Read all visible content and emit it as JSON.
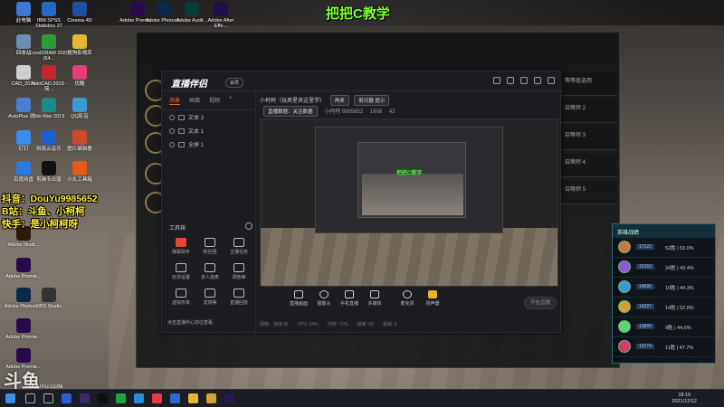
{
  "overlay_title": "把把C教学",
  "overlay_lines": [
    "抖音：DouYu9985652",
    "B站：斗鱼、小柯柯",
    "快手：是小柯柯呀"
  ],
  "desktop_icons": [
    {
      "label": "此电脑",
      "color": "#3a7bd5"
    },
    {
      "label": "IBM SPSS Statistics 27",
      "color": "#2468c9"
    },
    {
      "label": "Cinema 4D",
      "color": "#1e4fa3"
    },
    {
      "label": "Adobe Premie...",
      "color": "#2a0a4a"
    },
    {
      "label": "Adobe Photosh...",
      "color": "#0a2a4a"
    },
    {
      "label": "Adobe Audit...",
      "color": "#0a3a3a"
    },
    {
      "label": "Adobe After Effe...",
      "color": "#22104a"
    },
    {
      "label": "回收站",
      "color": "#6b8fb5"
    },
    {
      "label": "CorelDRAW 2020 (64...",
      "color": "#2d9b3a"
    },
    {
      "label": "搜狗影视库",
      "color": "#e6b733"
    },
    {
      "label": "CAD_2019",
      "color": "#cfcfcf"
    },
    {
      "label": "AutoCAD 2019 - 简...",
      "color": "#c4262e"
    },
    {
      "label": "优酷",
      "color": "#e6407a"
    },
    {
      "label": "AutoPlus 测...",
      "color": "#4a7fd5"
    },
    {
      "label": "3ds Max 2019",
      "color": "#1a8a8a"
    },
    {
      "label": "QQ影音",
      "color": "#3a9ad5"
    },
    {
      "label": "钉钉",
      "color": "#3a8ef0"
    },
    {
      "label": "网易云音乐",
      "color": "#1e5fcf"
    },
    {
      "label": "图片编辑器",
      "color": "#c94a2a"
    },
    {
      "label": "百度网盘",
      "color": "#2a7ae0"
    },
    {
      "label": "剪映专业版",
      "color": "#111111"
    },
    {
      "label": "小丸工具箱",
      "color": "#e35a1a"
    },
    {
      "label": "OBS Studio",
      "color": "#333333"
    },
    {
      "label": "Adobe Illustr...",
      "color": "#2b1a0a"
    },
    {
      "label": "Adobe Premie...",
      "color": "#2a0a4a"
    },
    {
      "label": "Adobe Photosh...",
      "color": "#0a2a4a"
    },
    {
      "label": "Adobe Premie...",
      "color": "#2a0a4a"
    },
    {
      "label": "Adobe Premie...",
      "color": "#2a0a4a"
    }
  ],
  "app": {
    "logo": "直播伴侣",
    "badge": "会员",
    "tabs": [
      "场景",
      "画面",
      "视频"
    ],
    "layers": [
      "文本 3",
      "文本 1",
      "全屏 1"
    ],
    "tools_header": "工具箱",
    "tools": [
      "弹幕助手",
      "粉丝团",
      "主播任务",
      "玩法设置",
      "多人连麦",
      "调色等",
      "虚拟形象",
      "滤镜等",
      "直播回放"
    ],
    "notice": "点击直播中心前往查看",
    "header_title": "小柯柯（玩男星来这里学）",
    "header_btn": "再来",
    "header_btn2": "剪切器 提示",
    "row2": [
      "直播数据：关注数据",
      "小柯柯 9985652",
      "1608",
      "42"
    ],
    "bottom_tools": [
      "直播画面",
      "摄像头",
      "手机直播",
      "多媒体",
      "麦克风",
      "扬声器"
    ],
    "start_button": "开始直播",
    "status": [
      "网络：连接 好",
      "CPU: 24%",
      "内存: 71%",
      "帧率: 60",
      "丢帧: 0"
    ]
  },
  "panel": {
    "title": "英雄战绩",
    "rows": [
      {
        "score": "17122",
        "text": "52胜 | 53.0%"
      },
      {
        "score": "15153",
        "text": "34胜 | 43.4%"
      },
      {
        "score": "14696",
        "text": "10胜 | 44.3%"
      },
      {
        "score": "14227",
        "text": "14胜 | 52.8%"
      },
      {
        "score": "13893",
        "text": "9胜 | 44.6%"
      },
      {
        "score": "13774",
        "text": "11胜 | 47.7%"
      }
    ]
  },
  "lol_side_rows": [
    "等等查选用",
    "召唤师 2",
    "召唤师 3",
    "召唤师 4",
    "召唤师 5"
  ],
  "taskbar": {
    "time": "18:19",
    "date": "2021/12/12"
  },
  "watermark": {
    "brand": "斗鱼",
    "url": "DOUYU.COM"
  },
  "colors": {
    "overlay_green": "#7cff2a",
    "overlay_yellow": "#ffee33",
    "accent": "#ff5f3a",
    "panel_border": "#2a6b73"
  }
}
